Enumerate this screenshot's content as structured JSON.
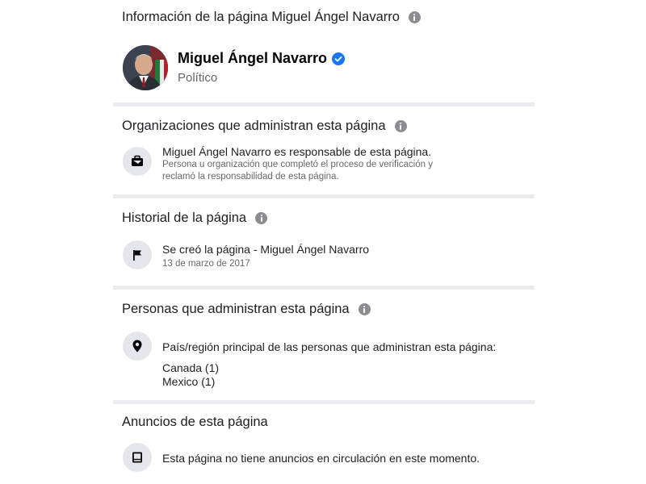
{
  "page_info": {
    "title": "Información de la página Miguel Ángel Navarro",
    "name": "Miguel Ángel Navarro",
    "category": "Político"
  },
  "organizations": {
    "title": "Organizaciones que administran esta página",
    "main": "Miguel Ángel Navarro es responsable de esta página.",
    "sub_line1": "Persona u organización que completó el proceso de verificación y",
    "sub_line2": "reclamó la responsabilidad de esta página."
  },
  "history": {
    "title": "Historial de la página",
    "event": "Se creó la página - Miguel Ángel Navarro",
    "date": "13 de marzo de 2017"
  },
  "admins": {
    "title": "Personas que administran esta página",
    "label": "País/región principal de las personas que administran esta página:",
    "countries": [
      "Canada (1)",
      "Mexico (1)"
    ]
  },
  "ads": {
    "title": "Anuncios de esta página",
    "text": "Esta página no tiene anuncios en circulación en este momento."
  },
  "icons": {
    "info": "info-icon",
    "verified": "verified-badge-icon",
    "organization": "briefcase-icon",
    "history": "flag-icon",
    "location": "location-pin-icon",
    "ads": "ad-screen-icon"
  },
  "colors": {
    "verified_blue": "#1877f2",
    "icon_bg": "#e4e6eb",
    "secondary_text": "#65676b",
    "divider": "#e9ebee"
  }
}
